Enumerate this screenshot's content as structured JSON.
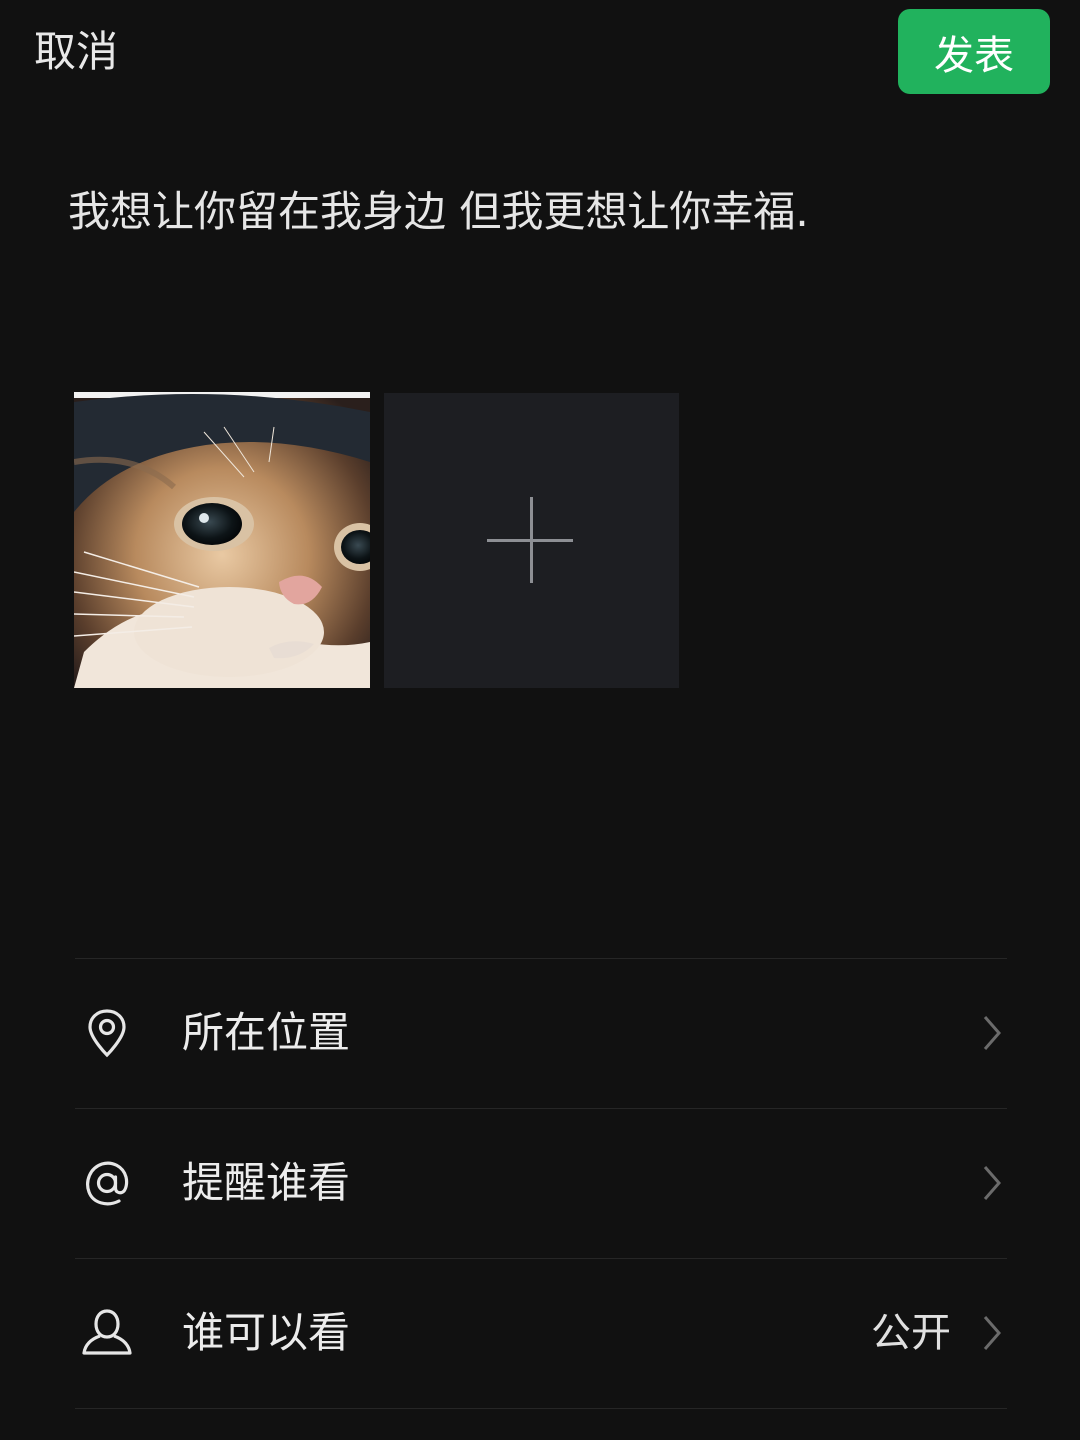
{
  "header": {
    "cancel_label": "取消",
    "publish_label": "发表"
  },
  "post": {
    "text": "我想让你留在我身边 但我更想让你幸福."
  },
  "media": {
    "add_icon": "plus-icon"
  },
  "options": [
    {
      "icon": "location-pin-icon",
      "label": "所在位置",
      "value": ""
    },
    {
      "icon": "at-sign-icon",
      "label": "提醒谁看",
      "value": ""
    },
    {
      "icon": "person-icon",
      "label": "谁可以看",
      "value": "公开"
    }
  ],
  "colors": {
    "background": "#111111",
    "accent": "#21b25d",
    "text": "#e6e6e6",
    "divider": "#262626"
  }
}
